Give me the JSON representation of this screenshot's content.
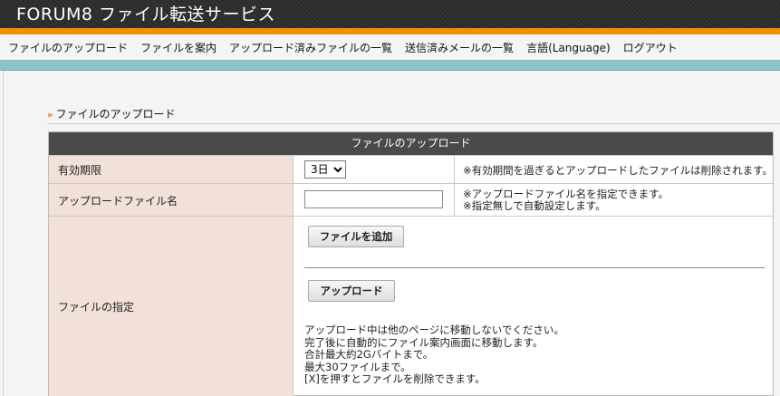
{
  "header": {
    "title": "FORUM8 ファイル転送サービス"
  },
  "nav": {
    "items": [
      "ファイルのアップロード",
      "ファイルを案内",
      "アップロード済みファイルの一覧",
      "送信済みメールの一覧",
      "言語(Language)",
      "ログアウト"
    ]
  },
  "section": {
    "title": "ファイルのアップロード"
  },
  "form": {
    "heading": "ファイルのアップロード",
    "expiry": {
      "label": "有効期限",
      "selected": "3日",
      "note": "※有効期間を過ぎるとアップロードしたファイルは削除されます。"
    },
    "filename": {
      "label": "アップロードファイル名",
      "value": "",
      "note1": "※アップロードファイル名を指定できます。",
      "note2": "※指定無しで自動設定します。"
    },
    "files": {
      "label": "ファイルの指定",
      "add_button": "ファイルを追加",
      "upload_button": "アップロード",
      "notes": [
        "アップロード中は他のページに移動しないでください。",
        "完了後に自動的にファイル案内画面に移動します。",
        "合計最大約2Gバイトまで。",
        "最大30ファイルまで。",
        "[X]を押すとファイルを削除できます。"
      ]
    }
  },
  "colors": {
    "header_bg": "#2f2f2f",
    "orange_accent": "#f39000",
    "teal_band": "#8fc3c3",
    "label_bg": "#f1e1d9",
    "table_head_bg": "#4a4a4a"
  }
}
